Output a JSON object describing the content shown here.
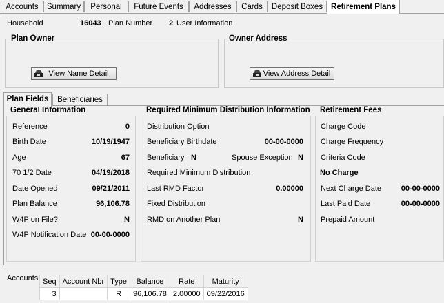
{
  "tabs": [
    "Accounts",
    "Summary",
    "Personal",
    "Future Events",
    "Addresses",
    "Cards",
    "Deposit Boxes",
    "Retirement Plans"
  ],
  "header": {
    "household_label": "Household",
    "household_value": "16043",
    "plan_number_label": "Plan Number",
    "plan_number_value": "2",
    "user_info_label": "User Information"
  },
  "plan_owner": {
    "title": "Plan Owner",
    "button": "View Name Detail"
  },
  "owner_address": {
    "title": "Owner Address",
    "button": "View Address Detail"
  },
  "inner_tabs": [
    "Plan Fields",
    "Beneficiaries"
  ],
  "general": {
    "title": "General Information",
    "rows": [
      {
        "label": "Reference",
        "value": "0"
      },
      {
        "label": "Birth Date",
        "value": "10/19/1947"
      },
      {
        "label": "Age",
        "value": "67"
      },
      {
        "label": "70 1/2 Date",
        "value": "04/19/2018"
      },
      {
        "label": "Date Opened",
        "value": "09/21/2011"
      },
      {
        "label": "Plan Balance",
        "value": "96,106.78"
      },
      {
        "label": "W4P on File?",
        "value": "N"
      },
      {
        "label": "W4P Notification Date",
        "value": "00-00-0000"
      }
    ]
  },
  "rmd": {
    "title": "Required Minimum Distribution Information",
    "distribution_option": "Distribution Option",
    "beneficiary_birthdate_label": "Beneficiary Birthdate",
    "beneficiary_birthdate_value": "00-00-0000",
    "beneficiary_label": "Beneficiary",
    "beneficiary_value": "N",
    "spouse_exception_label": "Spouse Exception",
    "spouse_exception_value": "N",
    "required_min_dist": "Required Minimum Distribution",
    "last_rmd_factor_label": "Last RMD Factor",
    "last_rmd_factor_value": "0.00000",
    "fixed_distribution": "Fixed Distribution",
    "rmd_another_label": "RMD on Another Plan",
    "rmd_another_value": "N"
  },
  "fees": {
    "title": "Retirement Fees",
    "charge_code": "Charge Code",
    "charge_frequency": "Charge Frequency",
    "criteria_code": "Criteria Code",
    "no_charge": "No Charge",
    "next_charge_label": "Next Charge Date",
    "next_charge_value": "00-00-0000",
    "last_paid_label": "Last Paid Date",
    "last_paid_value": "00-00-0000",
    "prepaid_amount": "Prepaid Amount"
  },
  "accounts": {
    "label": "Accounts",
    "columns": [
      "Seq",
      "Account Nbr",
      "Type",
      "Balance",
      "Rate",
      "Maturity"
    ],
    "rows": [
      {
        "seq": "3",
        "account_nbr": "",
        "type": "R",
        "balance": "96,106.78",
        "rate": "2.00000",
        "maturity": "09/22/2016"
      }
    ]
  }
}
